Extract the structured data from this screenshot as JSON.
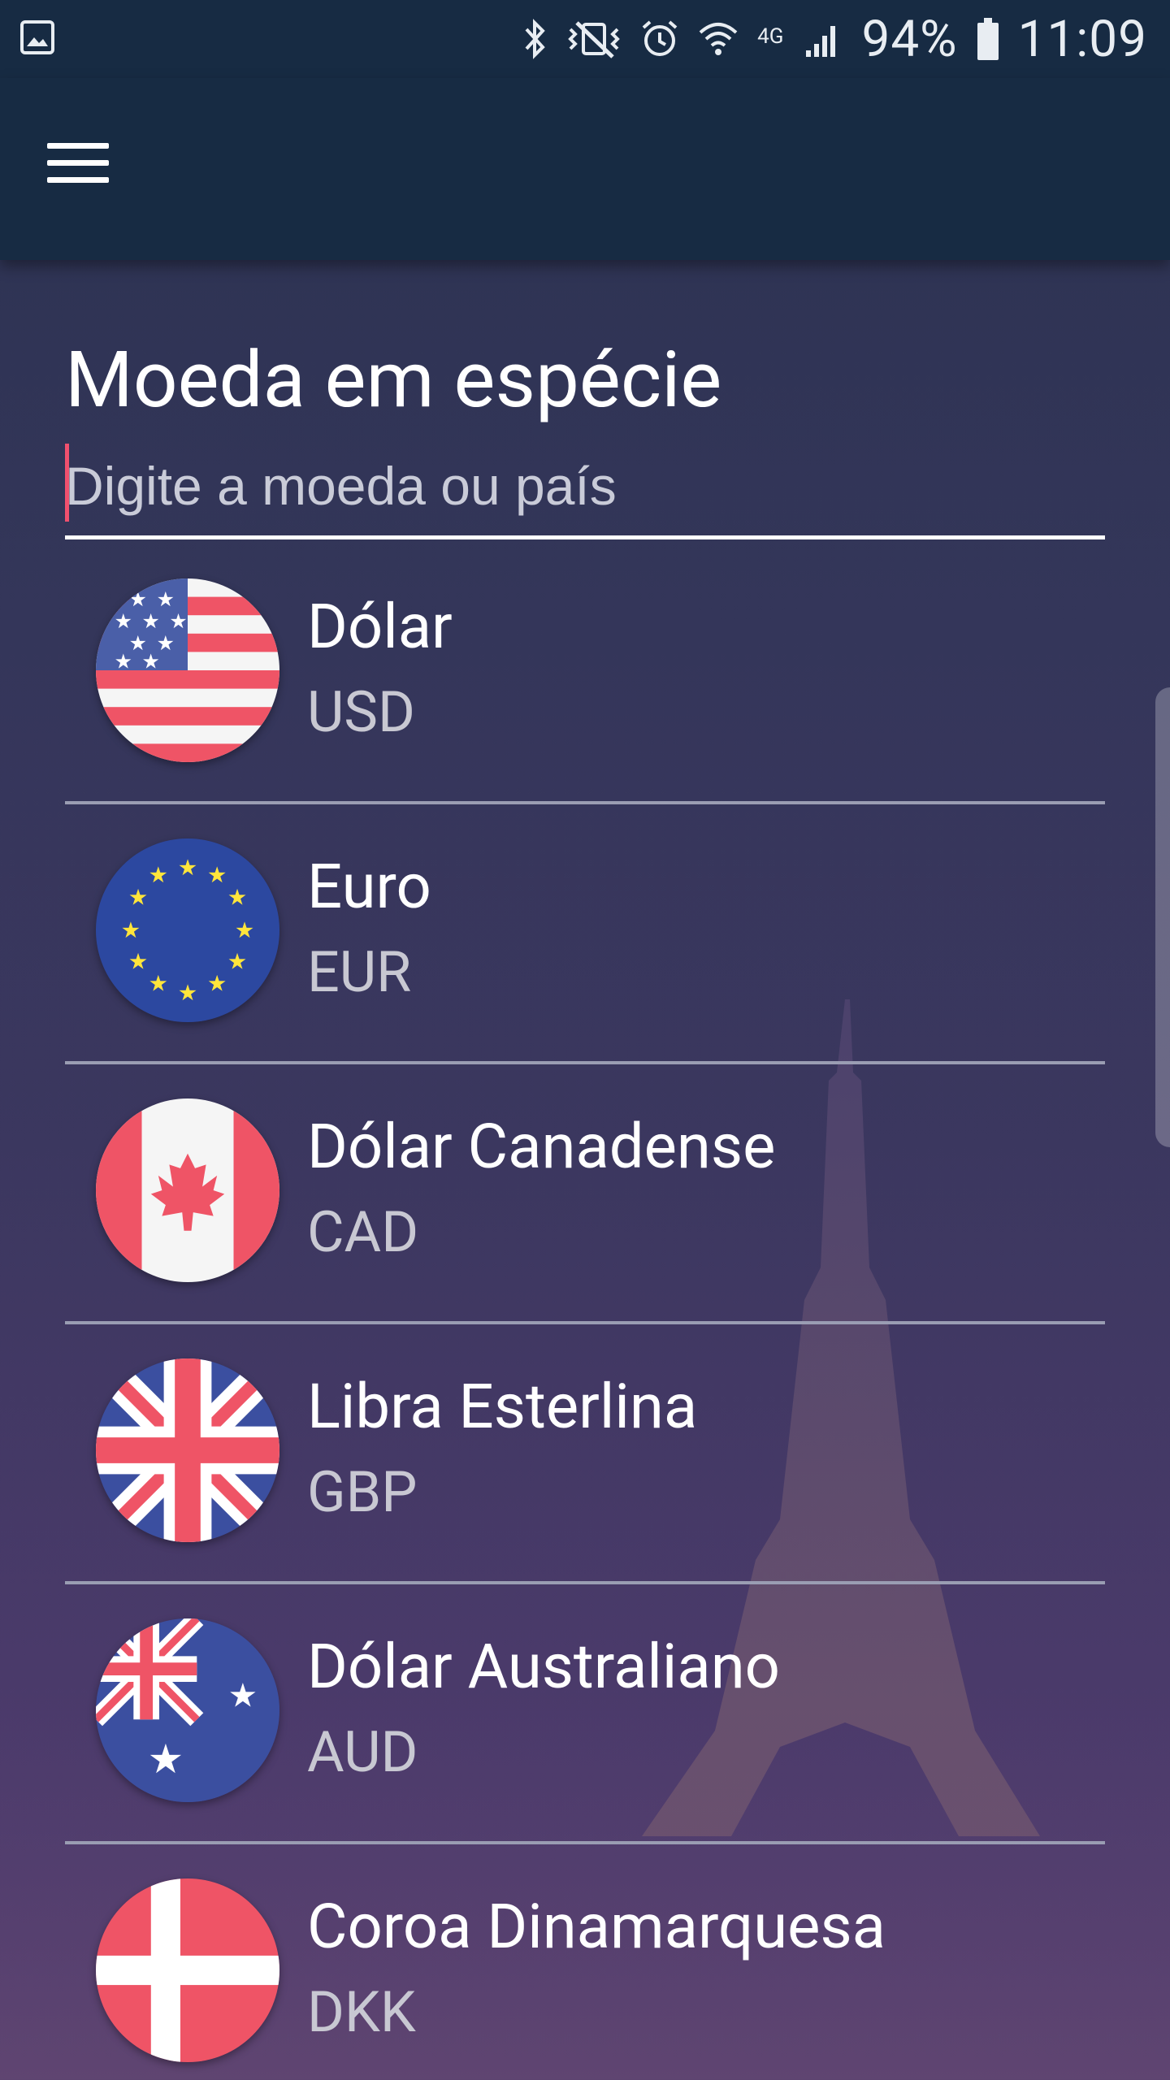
{
  "status_bar": {
    "battery": "94%",
    "time": "11:09",
    "network": "4G",
    "icons": [
      "gallery-icon",
      "bluetooth-icon",
      "vibrate-icon",
      "alarm-icon",
      "wifi-icon",
      "signal-icon",
      "battery-icon"
    ]
  },
  "app_bar": {
    "menu_icon": "hamburger-menu-icon"
  },
  "page": {
    "title": "Moeda em espécie",
    "search_placeholder": "Digite a moeda ou país",
    "accent_color": "#f0506e",
    "header_color": "#172b43"
  },
  "currencies": [
    {
      "name": "Dólar",
      "code": "USD",
      "flag": "us-flag-icon"
    },
    {
      "name": "Euro",
      "code": "EUR",
      "flag": "eu-flag-icon"
    },
    {
      "name": "Dólar Canadense",
      "code": "CAD",
      "flag": "canada-flag-icon"
    },
    {
      "name": "Libra Esterlina",
      "code": "GBP",
      "flag": "uk-flag-icon"
    },
    {
      "name": "Dólar Australiano",
      "code": "AUD",
      "flag": "australia-flag-icon"
    },
    {
      "name": "Coroa Dinamarquesa",
      "code": "DKK",
      "flag": "denmark-flag-icon"
    }
  ]
}
